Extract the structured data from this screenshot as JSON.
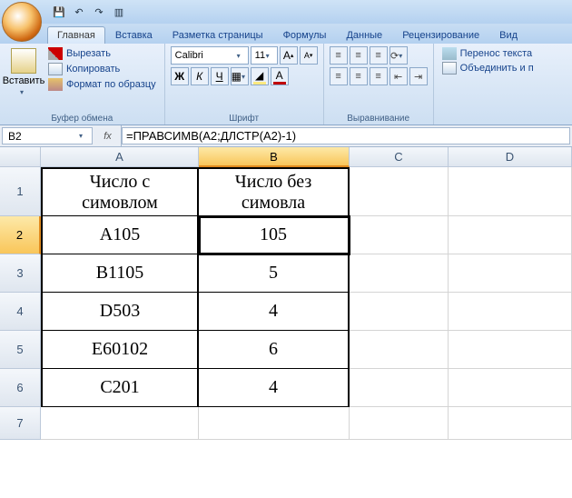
{
  "qat": {
    "save": "💾",
    "undo": "↶",
    "redo": "↷",
    "more": "▥"
  },
  "tabs": [
    "Главная",
    "Вставка",
    "Разметка страницы",
    "Формулы",
    "Данные",
    "Рецензирование",
    "Вид"
  ],
  "active_tab": 0,
  "ribbon": {
    "clipboard": {
      "paste": "Вставить",
      "cut": "Вырезать",
      "copy": "Копировать",
      "format": "Формат по образцу",
      "label": "Буфер обмена"
    },
    "font": {
      "name": "Calibri",
      "size": "11",
      "bold": "Ж",
      "italic": "К",
      "underline": "Ч",
      "label": "Шрифт",
      "grow": "A",
      "shrink": "A"
    },
    "align": {
      "label": "Выравнивание",
      "wrap": "Перенос текста",
      "merge": "Объединить и п"
    }
  },
  "namebox": "B2",
  "fx": "fx",
  "formula": "=ПРАВСИМВ(A2;ДЛСТР(A2)-1)",
  "columns": [
    "A",
    "B",
    "C",
    "D"
  ],
  "selected_col": "B",
  "selected_row": "2",
  "rows": [
    "1",
    "2",
    "3",
    "4",
    "5",
    "6",
    "7"
  ],
  "table": {
    "h1a": "Число с",
    "h1b": "симовлом",
    "h2a": "Число без",
    "h2b": "симовла",
    "data": [
      {
        "a": "А105",
        "b": "105"
      },
      {
        "a": "В1105",
        "b": "5"
      },
      {
        "a": "D503",
        "b": "4"
      },
      {
        "a": "E60102",
        "b": "6"
      },
      {
        "a": "C201",
        "b": "4"
      }
    ]
  }
}
